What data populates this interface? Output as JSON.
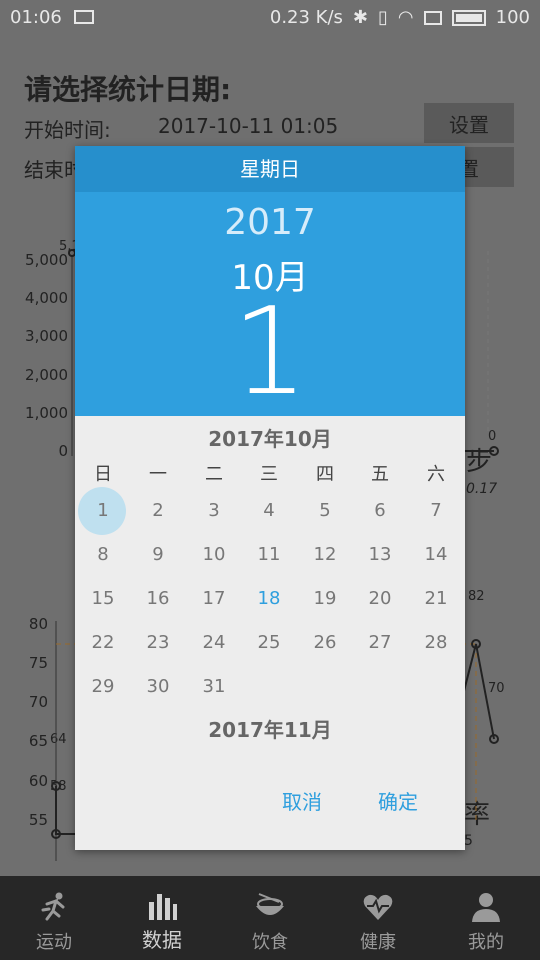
{
  "status": {
    "time": "01:06",
    "speed": "0.23 K/s",
    "battery": "100"
  },
  "page": {
    "title": "请选择统计日期:",
    "start_label": "开始时间:",
    "start_value": "2017-10-11 01:05",
    "end_label": "结束时",
    "set_label": "设置",
    "set_label_2": "置"
  },
  "chart1": {
    "yticks": [
      "5,000",
      "4,000",
      "3,000",
      "2,000",
      "1,000",
      "0"
    ],
    "label_right": "步",
    "end_value": "0",
    "date_tail": "0.17",
    "top_label": "5,1"
  },
  "chart2": {
    "yticks": [
      "80",
      "75",
      "70",
      "65",
      "60",
      "55"
    ],
    "points": [
      "64",
      "58",
      "82",
      "70"
    ],
    "label_right": "率",
    "tail": "5"
  },
  "dialog": {
    "weekday": "星期日",
    "year": "2017",
    "month": "10月",
    "day": "1",
    "month_title": "2017年10月",
    "next_month_title": "2017年11月",
    "dow": [
      "日",
      "一",
      "二",
      "三",
      "四",
      "五",
      "六"
    ],
    "weeks": [
      [
        "1",
        "2",
        "3",
        "4",
        "5",
        "6",
        "7"
      ],
      [
        "8",
        "9",
        "10",
        "11",
        "12",
        "13",
        "14"
      ],
      [
        "15",
        "16",
        "17",
        "18",
        "19",
        "20",
        "21"
      ],
      [
        "22",
        "23",
        "24",
        "25",
        "26",
        "27",
        "28"
      ],
      [
        "29",
        "30",
        "31",
        "",
        "",
        "",
        ""
      ]
    ],
    "today": "18",
    "cancel": "取消",
    "ok": "确定"
  },
  "nav": [
    {
      "label": "运动",
      "icon": "run-icon"
    },
    {
      "label": "数据",
      "icon": "bar-chart-icon"
    },
    {
      "label": "饮食",
      "icon": "bowl-icon"
    },
    {
      "label": "健康",
      "icon": "heart-icon"
    },
    {
      "label": "我的",
      "icon": "person-icon"
    }
  ],
  "colors": {
    "accent": "#2f9fde",
    "header": "#268fcc",
    "overlay": "#6f6f6f"
  }
}
